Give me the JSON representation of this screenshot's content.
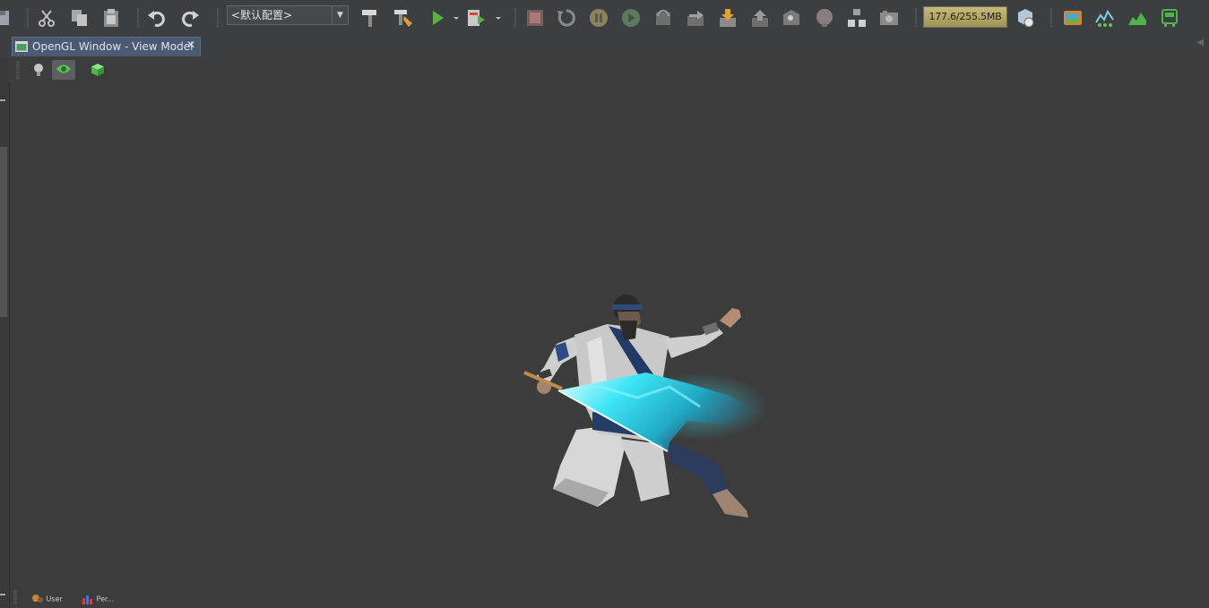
{
  "toolbar": {
    "config_select": {
      "value": "<默认配置>"
    },
    "memory_indicator": "177.6/255.5MB",
    "icons": [
      "save-all-icon",
      "cut-icon",
      "copy-icon",
      "paste-icon",
      "undo-icon",
      "redo-icon",
      "build-hammer-icon",
      "clean-build-icon",
      "run-icon",
      "run-dropdown-icon",
      "debug-icon",
      "debug-dropdown-icon",
      "stop-icon",
      "refresh-icon",
      "pause-icon",
      "continue-icon",
      "step-over-icon",
      "step-into-icon",
      "step-out-icon",
      "run-to-cursor-icon",
      "evaluate-icon",
      "breakpoint-icon",
      "hierarchy-icon",
      "screenshot-icon",
      "gc-icon",
      "image-viewer-icon",
      "profiler-icon",
      "chart-icon",
      "vehicle-icon"
    ]
  },
  "tabs": [
    {
      "label": "OpenGL Window - View Model",
      "icon": "window-icon",
      "close": "✕"
    }
  ],
  "viewport_toolbar": {
    "icons": [
      "light-icon",
      "eye-icon",
      "cube-icon"
    ]
  },
  "viewport": {
    "content": "3d-character-model",
    "background": "#3c3c3c"
  },
  "bottom_bar": {
    "items": [
      {
        "label": "User",
        "icon": "user-icon"
      },
      {
        "label": "Per...",
        "icon": "performance-icon"
      }
    ]
  },
  "colors": {
    "toolbar_bg": "#3c3f41",
    "tab_active": "#4b5a72",
    "viewport_bg": "#3c3c3c",
    "sword_glow": "#3ee6f5",
    "run_green": "#55b43a"
  }
}
